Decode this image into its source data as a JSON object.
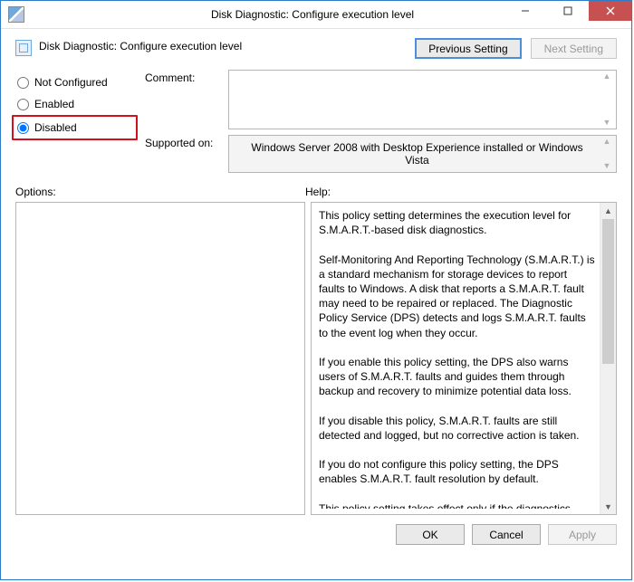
{
  "window": {
    "title": "Disk Diagnostic: Configure execution level"
  },
  "header": {
    "heading": "Disk Diagnostic: Configure execution level",
    "prev_label": "Previous Setting",
    "next_label": "Next Setting"
  },
  "radios": {
    "not_configured": "Not Configured",
    "enabled": "Enabled",
    "disabled": "Disabled",
    "selected": "disabled"
  },
  "comment": {
    "label": "Comment:",
    "value": ""
  },
  "supported": {
    "label": "Supported on:",
    "text": "Windows Server 2008 with Desktop Experience installed or Windows Vista"
  },
  "split": {
    "options_label": "Options:",
    "help_label": "Help:"
  },
  "help_text": "This policy setting determines the execution level for S.M.A.R.T.-based disk diagnostics.\n\nSelf-Monitoring And Reporting Technology (S.M.A.R.T.) is a standard mechanism for storage devices to report faults to Windows. A disk that reports a S.M.A.R.T. fault may need to be repaired or replaced. The Diagnostic Policy Service (DPS) detects and logs S.M.A.R.T. faults to the event log when they occur.\n\nIf you enable this policy setting, the DPS also warns users of S.M.A.R.T. faults and guides them through backup and recovery to minimize potential data loss.\n\nIf you disable this policy, S.M.A.R.T. faults are still detected and logged, but no corrective action is taken.\n\nIf you do not configure this policy setting, the DPS enables S.M.A.R.T. fault resolution by default.\n\nThis policy setting takes effect only if the diagnostics-wide scenario execution policy is not configured.",
  "footer": {
    "ok": "OK",
    "cancel": "Cancel",
    "apply": "Apply"
  }
}
